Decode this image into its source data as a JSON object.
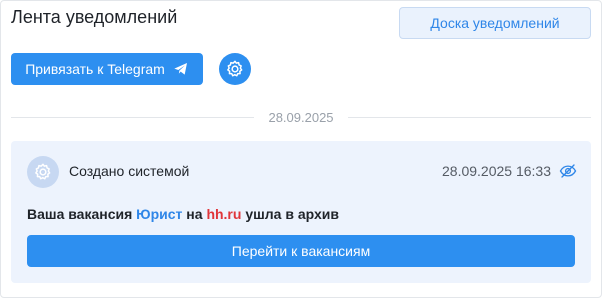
{
  "header": {
    "title": "Лента уведомлений",
    "board_button": "Доска уведомлений"
  },
  "actions": {
    "telegram_button": "Привязать к Telegram",
    "telegram_icon": "paper-plane-icon",
    "settings_icon": "gear-icon"
  },
  "feed": {
    "date": "28.09.2025",
    "notifications": [
      {
        "author": "Создано системой",
        "author_icon": "gear-icon",
        "timestamp": "28.09.2025 16:33",
        "status_icon": "eye-off-icon",
        "message_prefix": "Ваша вакансия",
        "job_title": "Юрист",
        "message_middle": "на",
        "site": "hh.ru",
        "message_suffix": "ушла в архив",
        "action_button": "Перейти к вакансиям"
      }
    ]
  },
  "colors": {
    "accent": "#2d8ff0",
    "link": "#2f86e8",
    "site": "#e0353a",
    "card_bg": "#edf3fd"
  }
}
